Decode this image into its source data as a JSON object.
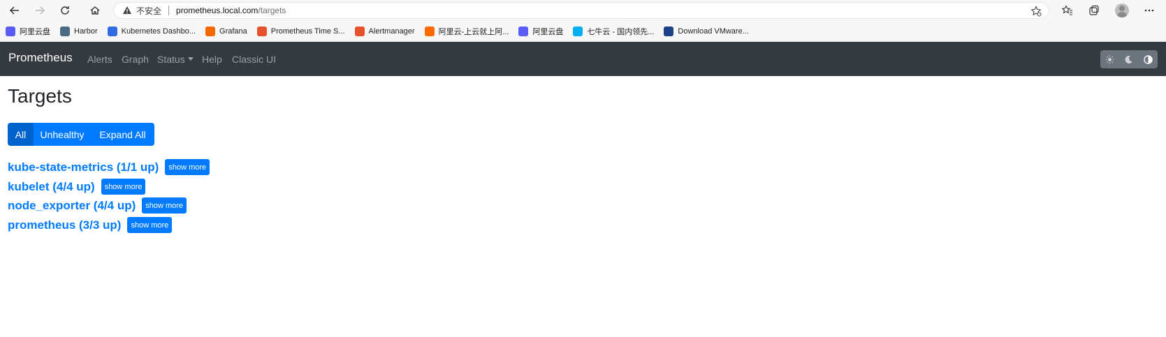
{
  "browser": {
    "security_label": "不安全",
    "url_host": "prometheus.local.com",
    "url_path": "/targets",
    "bookmarks": [
      {
        "label": "阿里云盘",
        "icon": "aliyun-drive-icon",
        "color": "#5b5bf6"
      },
      {
        "label": "Harbor",
        "icon": "harbor-icon",
        "color": "#4a6b82"
      },
      {
        "label": "Kubernetes Dashbo...",
        "icon": "kubernetes-icon",
        "color": "#326ce5"
      },
      {
        "label": "Grafana",
        "icon": "grafana-icon",
        "color": "#f46800"
      },
      {
        "label": "Prometheus Time S...",
        "icon": "prometheus-icon",
        "color": "#e6522c"
      },
      {
        "label": "Alertmanager",
        "icon": "alertmanager-icon",
        "color": "#e6522c"
      },
      {
        "label": "阿里云-上云就上阿...",
        "icon": "aliyun-icon",
        "color": "#ff6a00"
      },
      {
        "label": "阿里云盘",
        "icon": "aliyun-drive-icon",
        "color": "#5b5bf6"
      },
      {
        "label": "七牛云 - 国内领先...",
        "icon": "qiniu-icon",
        "color": "#06aeef"
      },
      {
        "label": "Download VMware...",
        "icon": "vmware-icon",
        "color": "#1d428a"
      }
    ]
  },
  "navbar": {
    "brand": "Prometheus",
    "links": [
      "Alerts",
      "Graph",
      "Status",
      "Help",
      "Classic UI"
    ]
  },
  "page": {
    "title": "Targets",
    "filters": [
      "All",
      "Unhealthy",
      "Expand All"
    ],
    "active_filter": "All",
    "show_more_label": "show more",
    "pools": [
      {
        "title": "kube-state-metrics (1/1 up)"
      },
      {
        "title": "kubelet (4/4 up)"
      },
      {
        "title": "node_exporter (4/4 up)"
      },
      {
        "title": "prometheus (3/3 up)"
      }
    ]
  },
  "colors": {
    "accent": "#007bff",
    "navbar_bg": "#343a40"
  }
}
